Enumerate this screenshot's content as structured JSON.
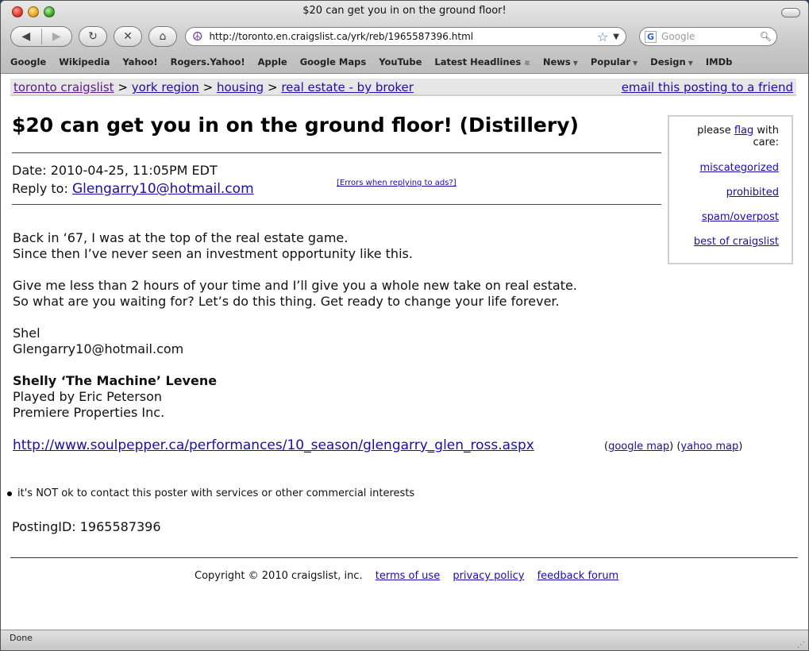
{
  "window": {
    "title": "$20 can get you in on the ground floor!"
  },
  "toolbar": {
    "back_icon": "back-arrow-icon",
    "forward_icon": "forward-arrow-icon",
    "url": "http://toronto.en.craigslist.ca/yrk/reb/1965587396.html",
    "search_placeholder": "Google"
  },
  "bookmarks": [
    {
      "label": "Google"
    },
    {
      "label": "Wikipedia"
    },
    {
      "label": "Yahoo!"
    },
    {
      "label": "Rogers.Yahoo!"
    },
    {
      "label": "Apple"
    },
    {
      "label": "Google Maps"
    },
    {
      "label": "YouTube"
    },
    {
      "label": "Latest Headlines"
    },
    {
      "label": "News"
    },
    {
      "label": "Popular"
    },
    {
      "label": "Design"
    },
    {
      "label": "IMDb"
    }
  ],
  "breadcrumb": {
    "items": [
      "toronto craigslist",
      "york region",
      "housing",
      "real estate - by broker"
    ],
    "sep": ">",
    "email_link": "email this posting to a friend"
  },
  "post": {
    "title": "$20 can get you in on the ground floor! (Distillery)",
    "date": "Date: 2010-04-25, 11:05PM EDT",
    "reply_label": "Reply to:",
    "reply_email": "Glengarry10@hotmail.com",
    "errors_link": "[Errors when replying to ads?]",
    "body": [
      "Back in ‘67, I was at the top of the real estate game.",
      "Since then I’ve never seen an investment opportunity like this.",
      "Give me less than 2 hours of your time and I’ll give you a whole new take on real estate.",
      "So what are you waiting for? Let’s do this thing. Get ready to change your life forever.",
      "Shel",
      "Glengarry10@hotmail.com",
      "Shelly ‘The Machine’ Levene",
      "Played by Eric Peterson",
      "Premiere Properties Inc."
    ],
    "link": "http://www.soulpepper.ca/performances/10_season/glengarry_glen_ross.aspx",
    "google_map": "google map",
    "yahoo_map": "yahoo map",
    "notice": "it's NOT ok to contact this poster with services or other commercial interests",
    "posting_id": "PostingID: 1965587396"
  },
  "flag": {
    "prefix": "please",
    "flag_link": "flag",
    "suffix": "with care:",
    "options": [
      "miscategorized",
      "prohibited",
      "spam/overpost",
      "best of craigslist"
    ]
  },
  "footer": {
    "copyright": "Copyright © 2010 craigslist, inc.",
    "links": [
      "terms of use",
      "privacy policy",
      "feedback forum"
    ]
  },
  "status": {
    "text": "Done"
  }
}
